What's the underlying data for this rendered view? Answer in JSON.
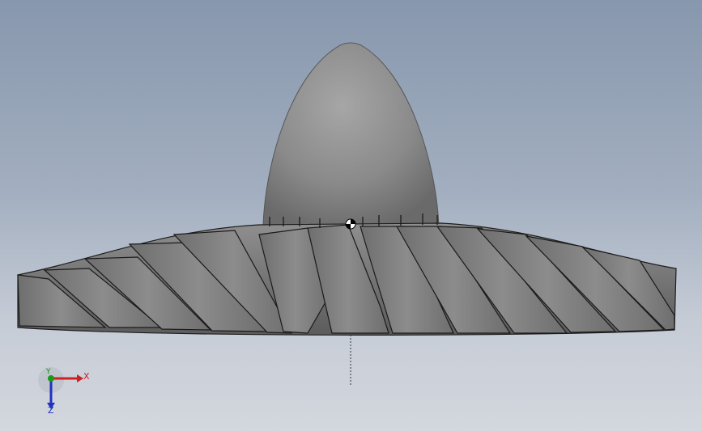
{
  "viewport": {
    "background_top": "#8797ad",
    "background_bottom": "#d3d7de"
  },
  "model": {
    "type": "impeller",
    "hub_color": "#8b8b8b",
    "blade_color": "#7a7a7a",
    "outline_color": "#1e1e1e",
    "icons": [
      "nose-cone",
      "blade-set",
      "origin-marker",
      "centerline"
    ]
  },
  "triad": {
    "x_label": "X",
    "y_label": "Y",
    "z_label": "Z",
    "x_color": "#d12020",
    "y_color": "#1a9a1a",
    "z_color": "#2030c0"
  }
}
